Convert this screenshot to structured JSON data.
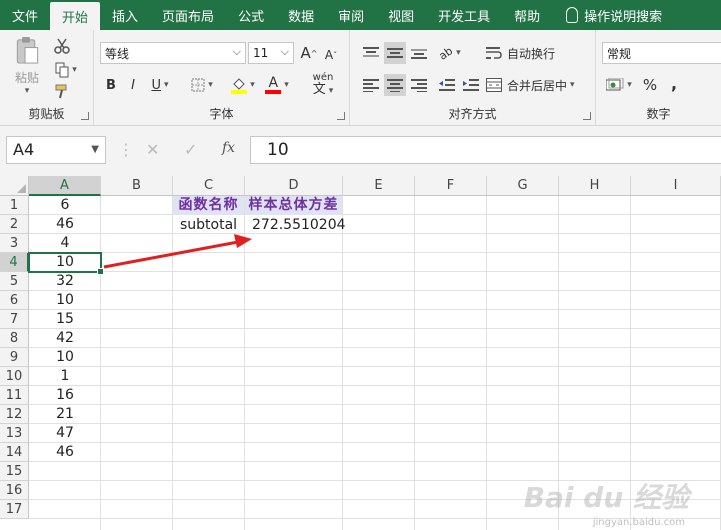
{
  "tabs": [
    "文件",
    "开始",
    "插入",
    "页面布局",
    "公式",
    "数据",
    "审阅",
    "视图",
    "开发工具",
    "帮助"
  ],
  "active_tab": "开始",
  "tell_me": "操作说明搜索",
  "ribbon": {
    "clipboard": {
      "label": "剪贴板",
      "paste": "粘贴"
    },
    "font": {
      "label": "字体",
      "font_name": "等线",
      "font_size": "11",
      "grow": "A",
      "shrink": "A",
      "bold": "B",
      "italic": "I",
      "underline": "U",
      "font_color_glyph": "A",
      "phonetic": "wén"
    },
    "alignment": {
      "label": "对齐方式",
      "wrap": "自动换行",
      "merge": "合并后居中",
      "orientation": "ab"
    },
    "number": {
      "label": "数字",
      "format": "常规",
      "percent": "%",
      "comma": ","
    }
  },
  "formula_bar": {
    "name_box": "A4",
    "cancel": "✕",
    "enter": "✓",
    "fx": "fx",
    "value": "10"
  },
  "sheet": {
    "columns": [
      "A",
      "B",
      "C",
      "D",
      "E",
      "F",
      "G",
      "H",
      "I"
    ],
    "rows": [
      "1",
      "2",
      "3",
      "4",
      "5",
      "6",
      "7",
      "8",
      "9",
      "10",
      "11",
      "12",
      "13",
      "14",
      "15",
      "16",
      "17"
    ],
    "col_a_values": [
      "6",
      "46",
      "4",
      "10",
      "32",
      "10",
      "15",
      "42",
      "10",
      "1",
      "16",
      "21",
      "47",
      "46"
    ],
    "c1": "函数名称",
    "d1": "样本总体方差",
    "c2": "subtotal",
    "d2": "272.5510204",
    "selected_cell": "A4",
    "selected_col": "A",
    "selected_row": "4"
  },
  "colors": {
    "excel_green": "#217346",
    "header_text": "#7030a0",
    "arrow": "#e02020"
  },
  "watermark": "Bai du 经验",
  "watermark_sub": "jingyan.baidu.com"
}
